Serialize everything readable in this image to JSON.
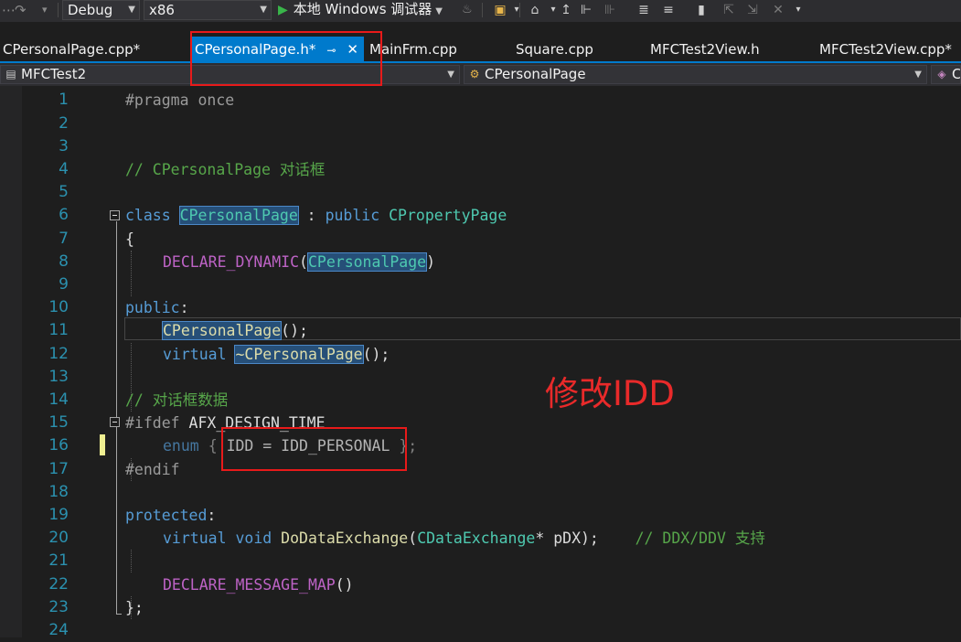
{
  "toolbar": {
    "configuration": "Debug",
    "platform": "x86",
    "run_label": "本地 Windows 调试器"
  },
  "tabs": [
    {
      "label": "CPersonalPage.cpp*",
      "active": false
    },
    {
      "label": "CPersonalPage.h*",
      "active": true
    },
    {
      "label": "MainFrm.cpp",
      "active": false
    },
    {
      "label": "Square.cpp",
      "active": false
    },
    {
      "label": "MFCTest2View.h",
      "active": false
    },
    {
      "label": "MFCTest2View.cpp*",
      "active": false
    }
  ],
  "nav": {
    "project": "MFCTest2",
    "scope": "CPersonalPage",
    "member_partial": "C"
  },
  "editor": {
    "line_numbers": [
      "1",
      "2",
      "3",
      "4",
      "5",
      "6",
      "7",
      "8",
      "9",
      "10",
      "11",
      "12",
      "13",
      "14",
      "15",
      "16",
      "17",
      "18",
      "19",
      "20",
      "21",
      "22",
      "23",
      "24"
    ],
    "tokens": {
      "pragma": "#pragma once",
      "comment_dialog": "// CPersonalPage 对话框",
      "class_kw": "class",
      "class_name": "CPersonalPage",
      "colon": " : ",
      "public_kw": "public",
      "base_class": "CPropertyPage",
      "brace_open": "{",
      "declare_dynamic": "DECLARE_DYNAMIC",
      "paren_open": "(",
      "paren_close": ")",
      "public_label": "public",
      "colon_only": ":",
      "ctor": "CPersonalPage",
      "ctor_tail": "();",
      "virtual_kw": "virtual",
      "tilde": "~",
      "dtor": "CPersonalPage",
      "dtor_tail": "();",
      "comment_data": "// 对话框数据",
      "ifdef": "#ifdef",
      "afx_macro": "AFX_DESIGN_TIME",
      "enum_kw": "enum",
      "enum_open": "{",
      "enum_body": "IDD = IDD_PERSONAL",
      "enum_close": "};",
      "endif": "#endif",
      "protected_kw": "protected",
      "void_kw": "void",
      "do_data_exchange": "DoDataExchange",
      "cdata_exchange": "CDataExchange",
      "param": "* pDX);",
      "comment_ddx": "// DDX/DDV 支持",
      "message_map": "DECLARE_MESSAGE_MAP",
      "message_map_tail": "()",
      "class_close": "};"
    }
  },
  "annotation": {
    "text": "修改IDD",
    "color": "#e81a1a"
  },
  "colors": {
    "accent": "#007acc",
    "keyword": "#569cd6",
    "type": "#4ec9b0",
    "function": "#dcdcaa",
    "macro": "#bd63c5",
    "comment": "#57a64a",
    "line_number": "#2b91af"
  }
}
